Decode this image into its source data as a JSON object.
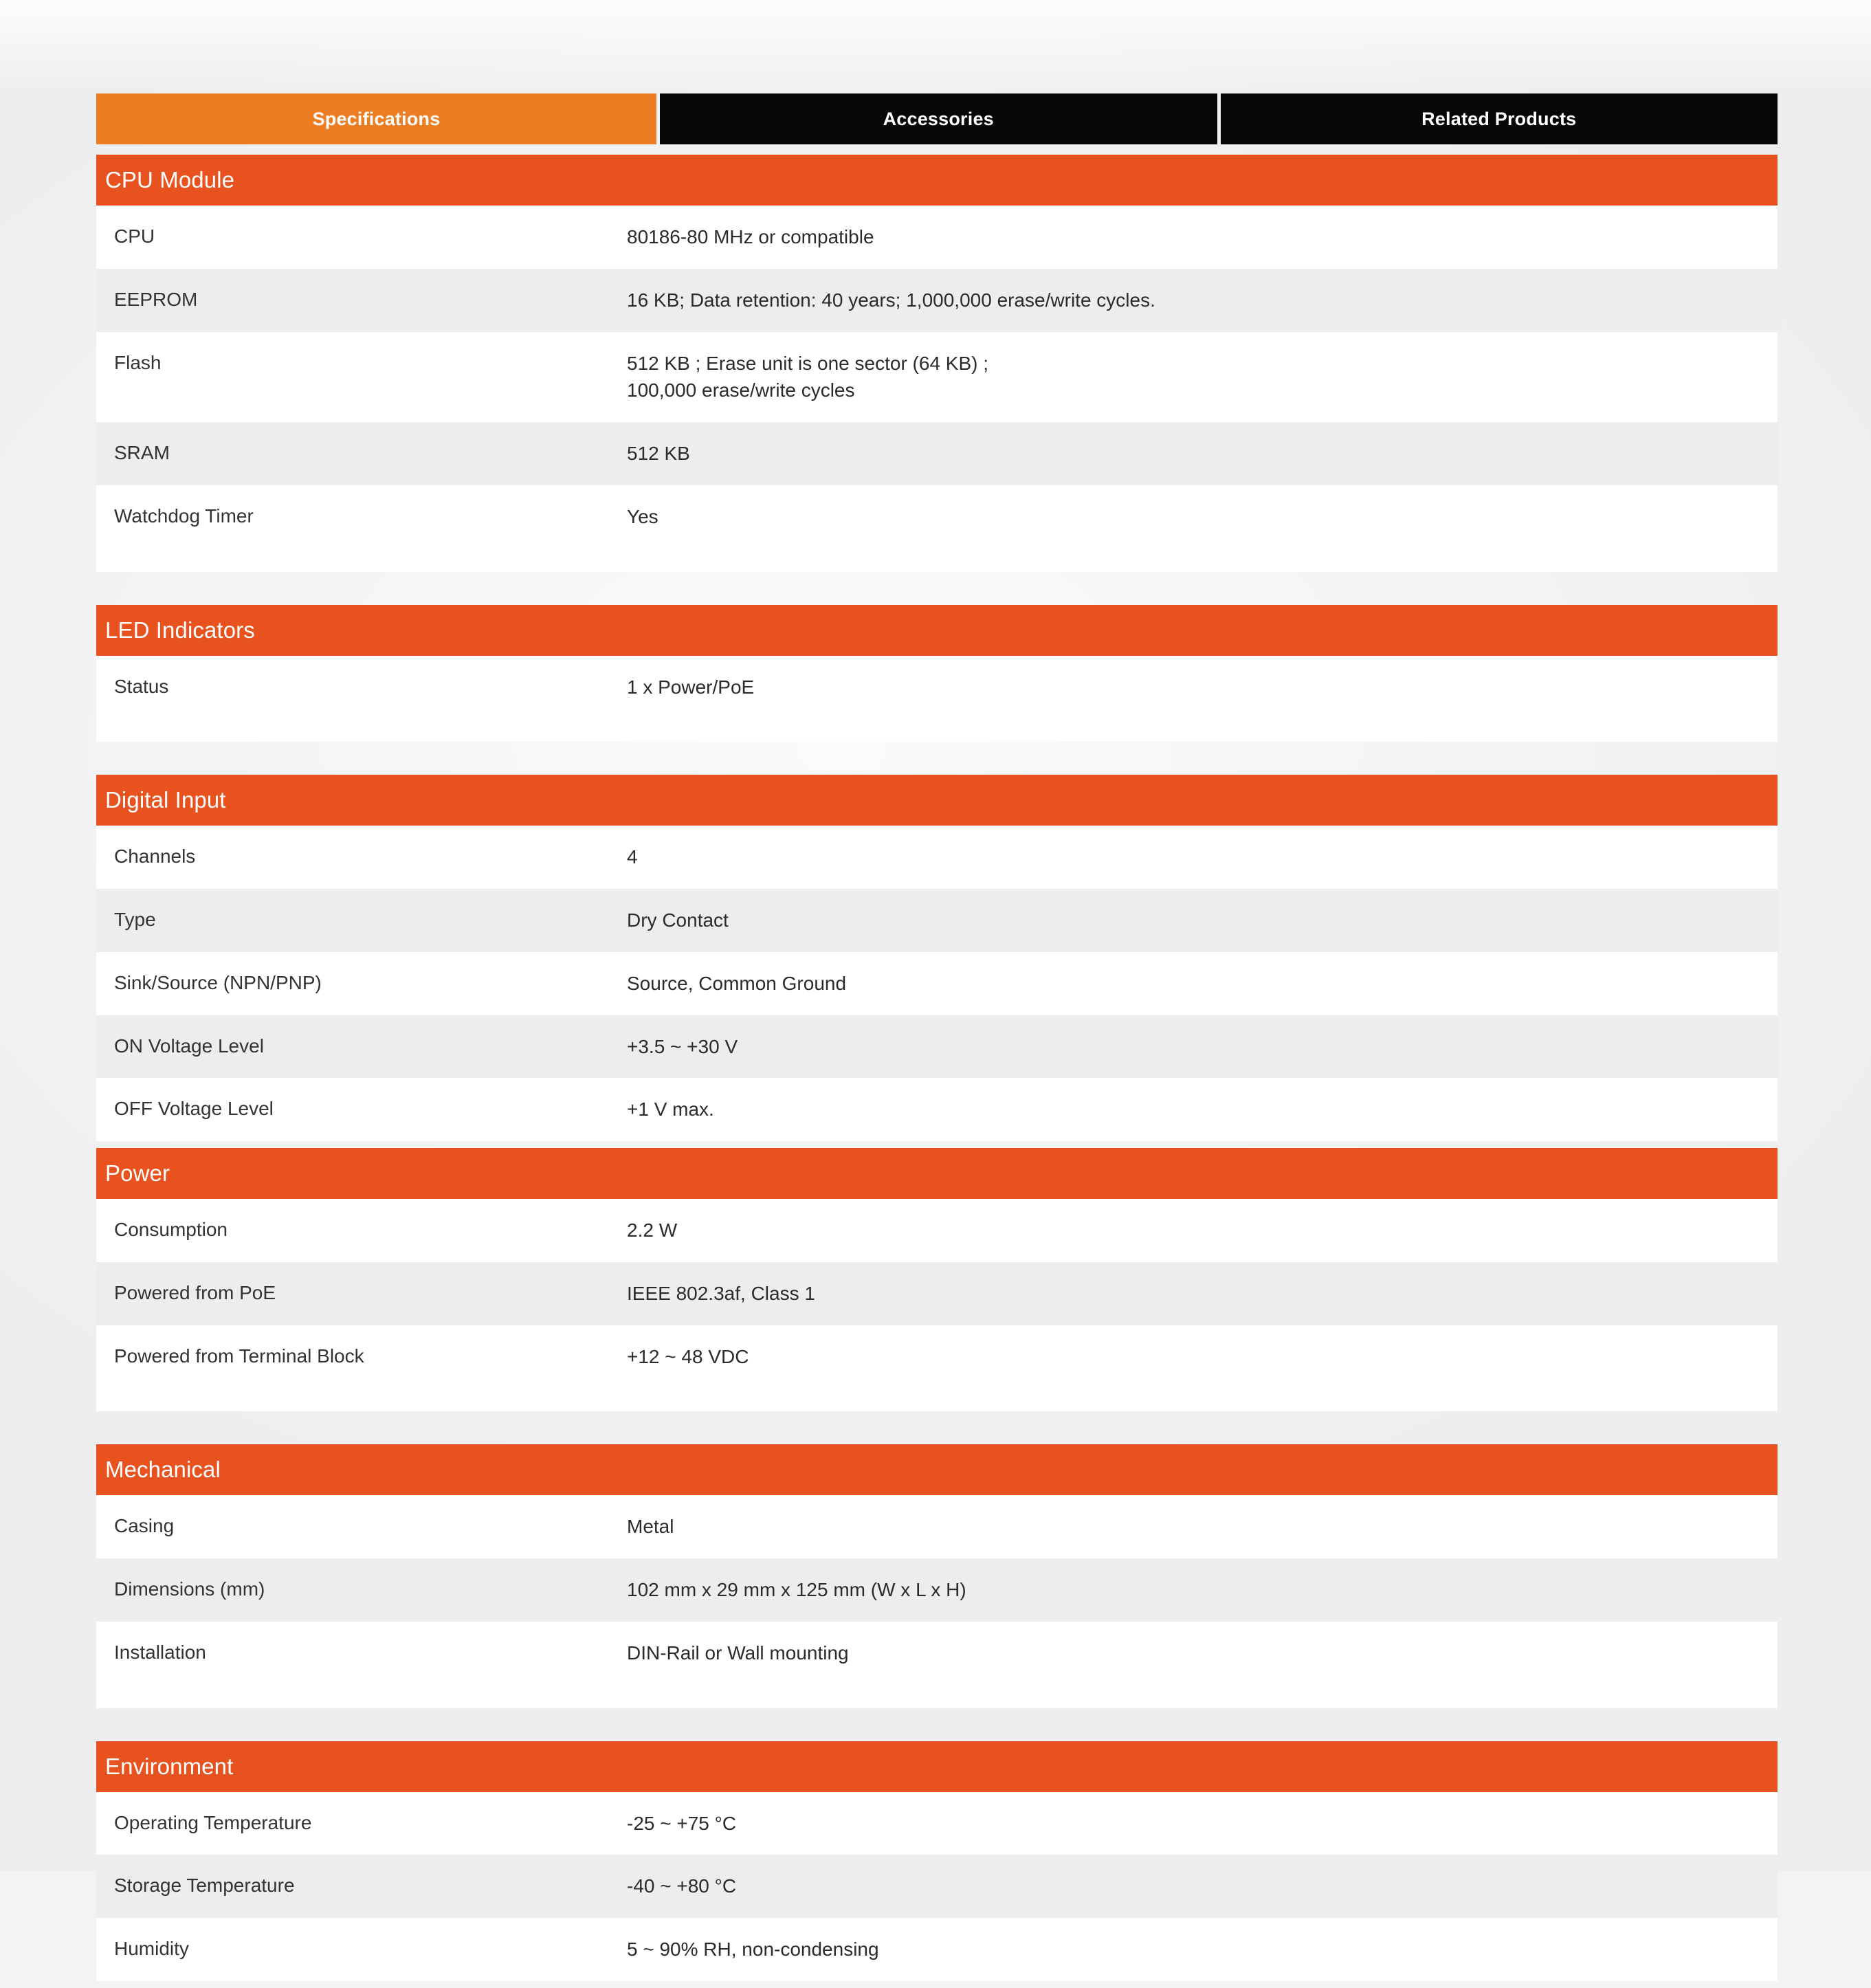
{
  "tabs": [
    {
      "label": "Specifications",
      "active": true
    },
    {
      "label": "Accessories",
      "active": false
    },
    {
      "label": "Related Products",
      "active": false
    }
  ],
  "colors": {
    "tab_active": "#ED7D22",
    "tab_inactive": "#050708",
    "section_header": "#E8521F",
    "row_alt": "#EDEDED",
    "row_base": "#FFFFFF",
    "page_bg": "#F2F3F5",
    "text": "#333333"
  },
  "sections": [
    {
      "title": "CPU Module",
      "tail": "large",
      "rows": [
        {
          "label": "CPU",
          "value": "80186-80 MHz or compatible"
        },
        {
          "label": "EEPROM",
          "value": "16 KB; Data retention: 40 years; 1,000,000 erase/write cycles."
        },
        {
          "label": "Flash",
          "value": "512 KB ; Erase unit is one sector (64 KB) ;\n100,000 erase/write cycles"
        },
        {
          "label": "SRAM",
          "value": "512 KB"
        },
        {
          "label": "Watchdog Timer",
          "value": "Yes"
        }
      ]
    },
    {
      "title": "LED Indicators",
      "tail": "large",
      "rows": [
        {
          "label": "Status",
          "value": "1 x Power/PoE"
        }
      ]
    },
    {
      "title": "Digital Input",
      "tail": "none",
      "rows": [
        {
          "label": "Channels",
          "value": "4"
        },
        {
          "label": "Type",
          "value": "Dry Contact"
        },
        {
          "label": "Sink/Source (NPN/PNP)",
          "value": "Source, Common Ground"
        },
        {
          "label": "ON Voltage Level",
          "value": "+3.5 ~ +30 V"
        },
        {
          "label": "OFF Voltage Level",
          "value": "+1 V max."
        }
      ]
    },
    {
      "title": "Power",
      "tail": "large",
      "rows": [
        {
          "label": "Consumption",
          "value": "2.2 W"
        },
        {
          "label": "Powered from PoE",
          "value": "IEEE 802.3af, Class 1"
        },
        {
          "label": "Powered from Terminal Block",
          "value": "+12 ~ 48 VDC"
        }
      ]
    },
    {
      "title": "Mechanical",
      "tail": "large",
      "rows": [
        {
          "label": "Casing",
          "value": "Metal"
        },
        {
          "label": "Dimensions (mm)",
          "value": "102 mm x 29 mm x 125 mm (W x L x H)"
        },
        {
          "label": "Installation",
          "value": "DIN-Rail or Wall mounting"
        }
      ]
    },
    {
      "title": "Environment",
      "tail": "none",
      "rows": [
        {
          "label": "Operating Temperature",
          "value": "-25 ~ +75 °C"
        },
        {
          "label": "Storage Temperature",
          "value": "-40 ~ +80 °C"
        },
        {
          "label": "Humidity",
          "value": "5 ~ 90% RH, non-condensing"
        }
      ]
    }
  ]
}
